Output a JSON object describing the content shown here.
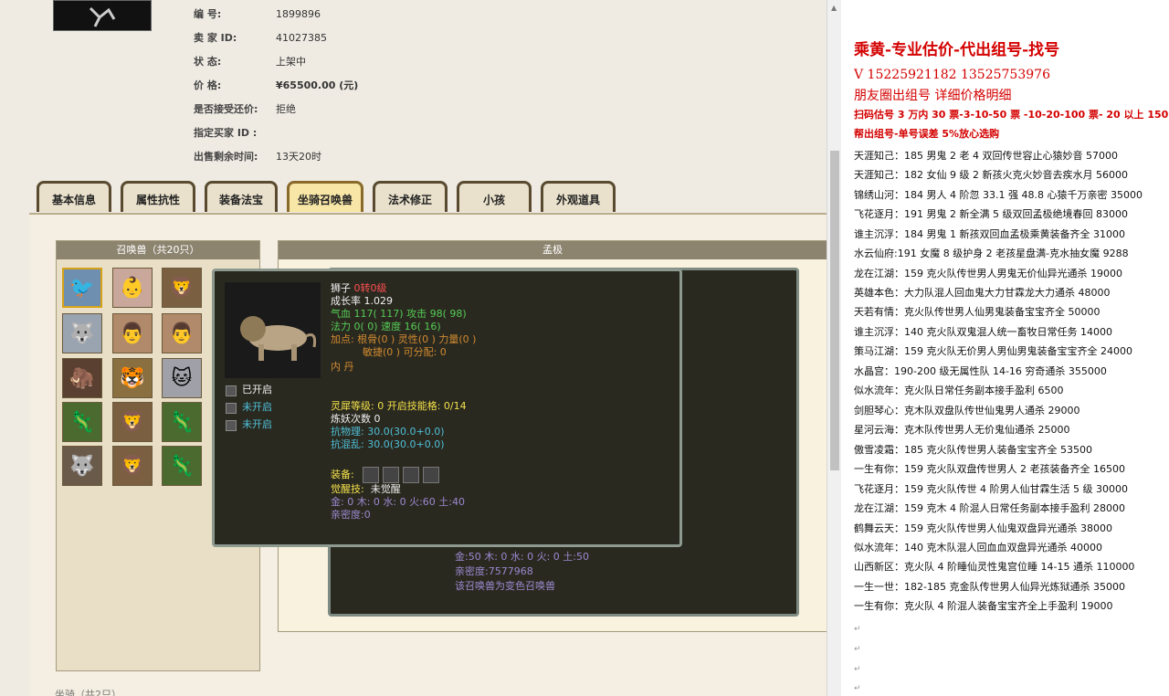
{
  "listing": {
    "rows": [
      {
        "key": "编        号:",
        "value": "1899896"
      },
      {
        "key": "卖    家  ID:",
        "value": "41027385"
      },
      {
        "key": "状        态:",
        "value": "上架中"
      },
      {
        "key": "价        格:",
        "value": "¥65500.00 (元)"
      },
      {
        "key": "是否接受还价:",
        "value": "拒绝"
      },
      {
        "key": "指定买家 ID :",
        "value": ""
      },
      {
        "key": "出售剩余时间:",
        "value": "13天20时"
      }
    ]
  },
  "tabs": [
    "基本信息",
    "属性抗性",
    "装备法宝",
    "坐骑召唤兽",
    "法术修正",
    "小孩",
    "外观道具"
  ],
  "active_tab": "坐骑召唤兽",
  "summons_title": "召唤兽（共20只）",
  "detail_title": "孟极",
  "under_text": {
    "elements": "金:50 木: 0 水: 0 火: 0 土:50",
    "intimacy": "亲密度:7577968",
    "note": "该召唤兽为变色召唤兽"
  },
  "tooltip": {
    "name": "狮子",
    "level": "0转0级",
    "growth": "成长率 1.029",
    "hp_label": "气血",
    "hp": "117( 117)",
    "atk_label": "攻击",
    "atk": "98( 98)",
    "mp_label": "法力",
    "mp": "0( 0)",
    "spd_label": "速度",
    "spd": "16( 16)",
    "points_line1": "加点:  根骨(0 ) 灵性(0 ) 力量(0 )",
    "points_line2": "敏捷(0 ) 可分配:   0",
    "neidan": "内  丹",
    "slots": [
      "已开启",
      "未开启",
      "未开启"
    ],
    "spirit": "灵犀等级:  0  开启技能格:   0/14",
    "refine": "炼妖次数 0",
    "resist_phys": "抗物理: 30.0(30.0+0.0)",
    "resist_chaos": "抗混乱: 30.0(30.0+0.0)",
    "equip_label": "装备:",
    "awaken_label": "觉醒技:",
    "awaken_value": "未觉醒",
    "elements": "金: 0 木: 0 水: 0 火:60 土:40",
    "intimacy": "亲密度:0"
  },
  "bottom_tab_label": "坐骑（共2只）",
  "right_panel": {
    "title": "乘黄-专业估价-代出组号-找号",
    "phone": "V 15225921182   13525753976",
    "sub": "朋友圈出组号     详细价格明细",
    "promo1": "扫码估号 3 万内 30 票-3-10-50 票  -10-20-100 票- 20 以上 150",
    "promo2": "帮出组号-单号误差 5%放心选购",
    "lines": [
      "天涯知己：185 男鬼 2 老 4 双回传世容止心猿妙音 57000",
      "天涯知己：182 女仙 9 级 2 新孩火克火妙音去疾水月 56000",
      "锦绣山河：184 男人 4 阶忽 33.1 强 48.8 心猿千万亲密 35000",
      "飞花逐月：191 男鬼 2 新全满 5 级双回孟极绝境春回 83000",
      "谁主沉浮：184 男鬼 1 新孩双回血孟极乘黄装备齐全 31000",
      "水云仙府:191 女魔 8 级护身 2 老孩星盘满-克水抽女魔 9288",
      "龙在江湖：159 克火队传世男人男鬼无价仙异光通杀 19000",
      "英雄本色：大力队混人回血鬼大力甘霖龙大力通杀 48000",
      "天若有情：克火队传世男人仙男鬼装备宝宝齐全 50000",
      "谁主沉浮：140 克火队双鬼混人统一畜牧日常任务 14000",
      "策马江湖：159 克火队无价男人男仙男鬼装备宝宝齐全 24000",
      "水晶宫：190-200 级无属性队 14-16 穷奇通杀 355000",
      "似水流年：克火队日常任务副本接手盈利 6500",
      "剑胆琴心：克木队双盘队传世仙鬼男人通杀 29000",
      "星河云海：克木队传世男人无价鬼仙通杀 25000",
      "傲雪凌霜：185 克火队传世男人装备宝宝齐全 53500",
      "一生有你：159 克火队双盘传世男人 2 老孩装备齐全 16500",
      "飞花逐月：159 克火队传世 4 阶男人仙甘霖生活 5 级 30000",
      "龙在江湖：159 克木 4 阶混人日常任务副本接手盈利 28000",
      "鹤舞云天：159 克火队传世男人仙鬼双盘异光通杀 38000",
      "似水流年：140 克木队混人回血血双盘异光通杀 40000",
      "山西新区：克火队 4 阶睡仙灵性鬼宫位睡 14-15 通杀 110000",
      "一生一世：182-185 克金队传世男人仙异光炼狱通杀 35000",
      "一生有你：克火队 4 阶混人装备宝宝齐全上手盈利 19000"
    ]
  }
}
